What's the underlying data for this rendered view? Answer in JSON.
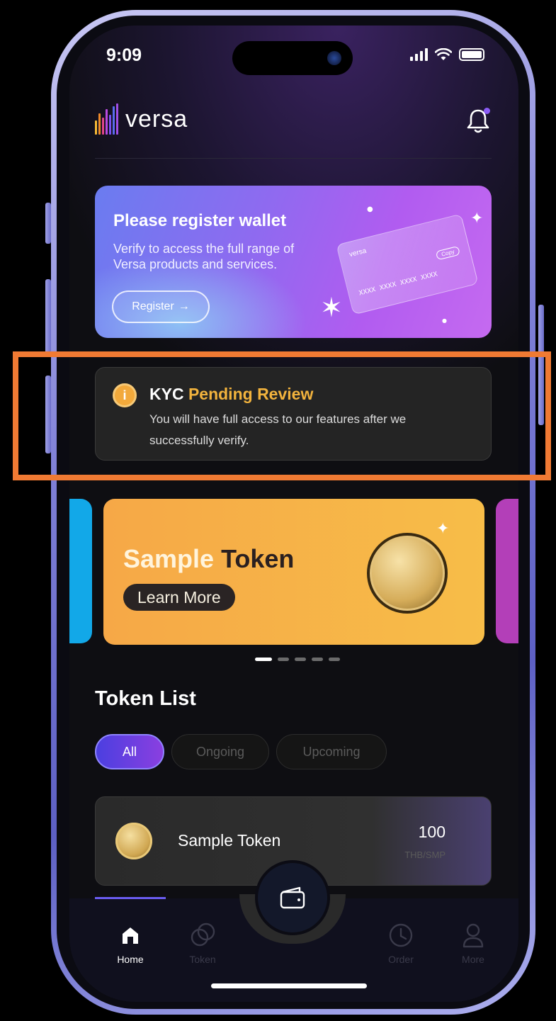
{
  "status_bar": {
    "time": "9:09"
  },
  "header": {
    "brand": "versa"
  },
  "register_card": {
    "title": "Please register wallet",
    "description": "Verify to access the full range of  Versa products and services.",
    "button_label": "Register",
    "card_brand": "versa",
    "card_number": "XXXX XXXX XXXX XXXX",
    "card_copy": "Copy"
  },
  "kyc": {
    "title_prefix": "KYC",
    "title_status": "Pending Review",
    "description": "You will have full access to our features after we successfully verify."
  },
  "carousel": {
    "banner_title_1": "Sample",
    "banner_title_2": "Token",
    "button_label": "Learn More",
    "slide_count": 5,
    "active_slide": 1
  },
  "token_list": {
    "title": "Token List",
    "filters": {
      "all": "All",
      "ongoing": "Ongoing",
      "upcoming": "Upcoming"
    },
    "items": [
      {
        "name": "Sample Token",
        "value": "100",
        "unit": "THB/SMP"
      }
    ]
  },
  "bottom_nav": {
    "home": "Home",
    "token": "Token",
    "order": "Order",
    "more": "More"
  },
  "colors": {
    "accent": "#6a5cf0",
    "kyc_status": "#f2b33d",
    "highlight": "#f07a33"
  }
}
